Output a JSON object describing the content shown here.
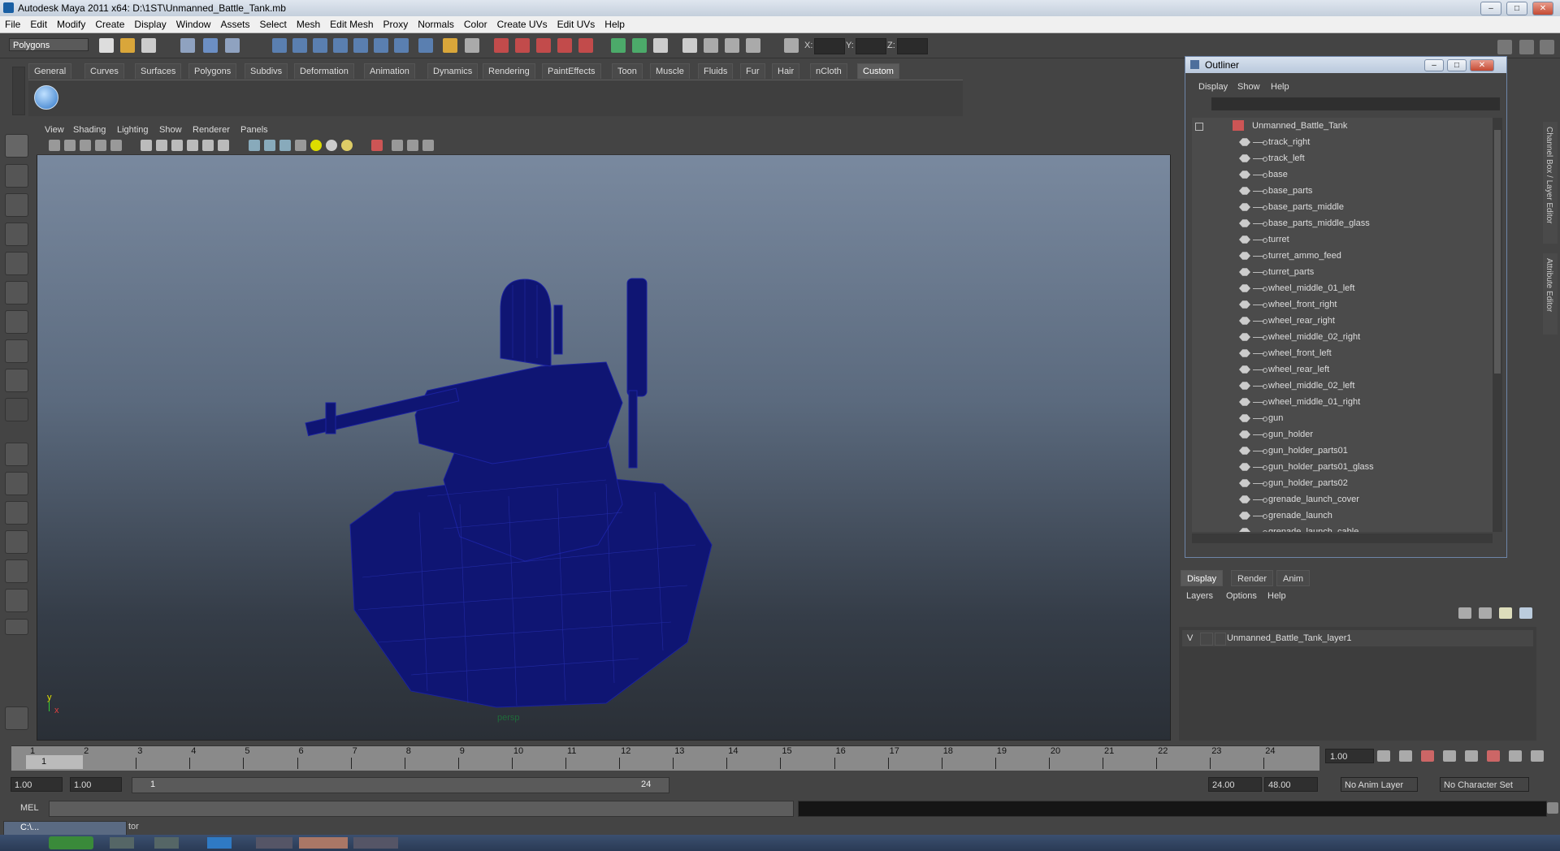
{
  "window": {
    "title": "Autodesk Maya 2011 x64: D:\\1ST\\Unmanned_Battle_Tank.mb",
    "min": "–",
    "max": "□",
    "close": "✕"
  },
  "menubar": [
    "File",
    "Edit",
    "Modify",
    "Create",
    "Display",
    "Window",
    "Assets",
    "Select",
    "Mesh",
    "Edit Mesh",
    "Proxy",
    "Normals",
    "Color",
    "Create UVs",
    "Edit UVs",
    "Help"
  ],
  "status": {
    "mode": "Polygons",
    "x_label": "X:",
    "y_label": "Y:",
    "z_label": "Z:"
  },
  "shelf": {
    "tabs": [
      "General",
      "Curves",
      "Surfaces",
      "Polygons",
      "Subdivs",
      "Deformation",
      "Animation",
      "Dynamics",
      "Rendering",
      "PaintEffects",
      "Toon",
      "Muscle",
      "Fluids",
      "Fur",
      "Hair",
      "nCloth",
      "Custom"
    ],
    "active": "Custom"
  },
  "viewport": {
    "menu": [
      "View",
      "Shading",
      "Lighting",
      "Show",
      "Renderer",
      "Panels"
    ],
    "camera": "persp",
    "axis_y": "y",
    "axis_x": "x"
  },
  "outliner": {
    "title": "Outliner",
    "menu": [
      "Display",
      "Show",
      "Help"
    ],
    "root": "Unmanned_Battle_Tank",
    "items": [
      "track_right",
      "track_left",
      "base",
      "base_parts",
      "base_parts_middle",
      "base_parts_middle_glass",
      "turret",
      "turret_ammo_feed",
      "turret_parts",
      "wheel_middle_01_left",
      "wheel_front_right",
      "wheel_rear_right",
      "wheel_middle_02_right",
      "wheel_front_left",
      "wheel_rear_left",
      "wheel_middle_02_left",
      "wheel_middle_01_right",
      "gun",
      "gun_holder",
      "gun_holder_parts01",
      "gun_holder_parts01_glass",
      "gun_holder_parts02",
      "grenade_launch_cover",
      "grenade_launch",
      "grenade_launch_cable"
    ]
  },
  "side_tabs": {
    "channel_box": "Channel Box / Layer Editor",
    "attribute_editor": "Attribute Editor"
  },
  "layers": {
    "tabs": [
      "Display",
      "Render",
      "Anim"
    ],
    "active": "Display",
    "menu": [
      "Layers",
      "Options",
      "Help"
    ],
    "layer_visible": "V",
    "layer_name": "Unmanned_Battle_Tank_layer1"
  },
  "timeline": {
    "frames": [
      "1",
      "2",
      "3",
      "4",
      "5",
      "6",
      "7",
      "8",
      "9",
      "10",
      "11",
      "12",
      "13",
      "14",
      "15",
      "16",
      "17",
      "18",
      "19",
      "20",
      "21",
      "22",
      "23",
      "24"
    ],
    "current_frame": "1.00",
    "current_marker": "1"
  },
  "range": {
    "start": "1.00",
    "start2": "1.00",
    "range_start": "1",
    "range_end": "24",
    "end": "24.00",
    "end2": "48.00",
    "anim_layer": "No Anim Layer",
    "char_set": "No Character Set"
  },
  "cmd": {
    "label": "MEL"
  },
  "taskbar": {
    "item": "C:\\...",
    "suffix": "tor"
  },
  "colors": {
    "wire": "#0f1573",
    "bg_top": "#7d8da3",
    "bg_bottom": "#2a2f36"
  }
}
